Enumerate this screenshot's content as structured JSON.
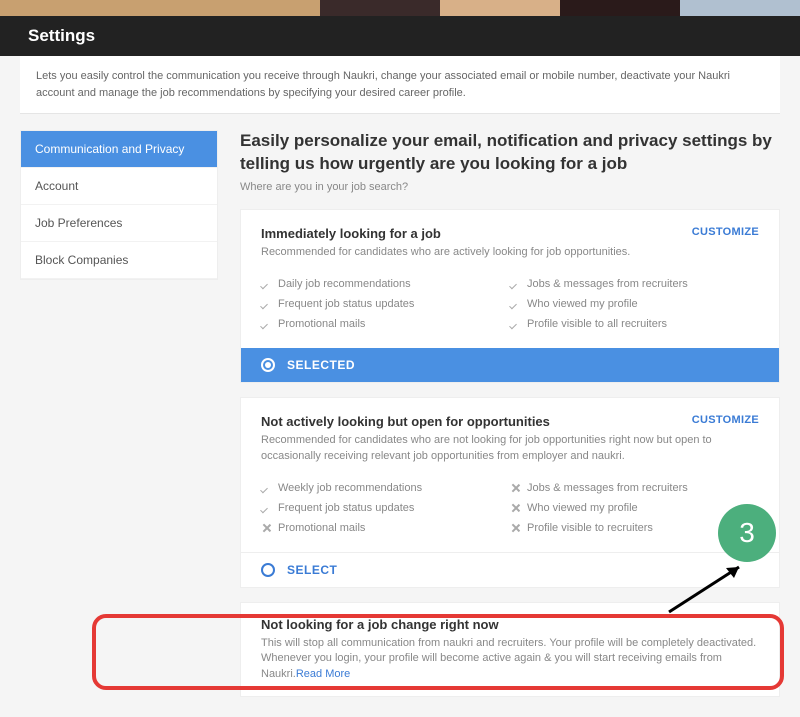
{
  "header": {
    "title": "Settings"
  },
  "intro": "Lets you easily control the communication you receive through Naukri, change your associated email or mobile number, deactivate your Naukri account and manage the job recommendations by specifying your desired career profile.",
  "sidebar": {
    "items": [
      {
        "label": "Communication and Privacy",
        "active": true
      },
      {
        "label": "Account",
        "active": false
      },
      {
        "label": "Job Preferences",
        "active": false
      },
      {
        "label": "Block Companies",
        "active": false
      }
    ]
  },
  "content": {
    "heading": "Easily personalize your email, notification and privacy settings by telling us how urgently are you looking for a job",
    "subheading": "Where are you in your job search?",
    "customize_label": "CUSTOMIZE",
    "selected_label": "SELECTED",
    "select_label": "SELECT",
    "read_more": "Read More"
  },
  "options": [
    {
      "title": "Immediately looking for a job",
      "desc": "Recommended for candidates who are actively looking for job opportunities.",
      "selected": true,
      "left": [
        {
          "icon": "check",
          "text": "Daily job recommendations"
        },
        {
          "icon": "check",
          "text": "Frequent job status updates"
        },
        {
          "icon": "check",
          "text": "Promotional mails"
        }
      ],
      "right": [
        {
          "icon": "check",
          "text": "Jobs & messages from recruiters"
        },
        {
          "icon": "check",
          "text": "Who viewed my profile"
        },
        {
          "icon": "check",
          "text": "Profile visible to all recruiters"
        }
      ]
    },
    {
      "title": "Not actively looking but open for opportunities",
      "desc": "Recommended for candidates who are not looking for job opportunities right now but open to occasionally receiving relevant job opportunities from employer and naukri.",
      "selected": false,
      "left": [
        {
          "icon": "check",
          "text": "Weekly job recommendations"
        },
        {
          "icon": "check",
          "text": "Frequent job status updates"
        },
        {
          "icon": "x",
          "text": "Promotional mails"
        }
      ],
      "right": [
        {
          "icon": "x",
          "text": "Jobs & messages from recruiters"
        },
        {
          "icon": "x",
          "text": "Who viewed my profile"
        },
        {
          "icon": "x",
          "text": "Profile visible to recruiters"
        }
      ]
    },
    {
      "title": "Not looking for a job change right now",
      "desc": "This will stop all communication from naukri and recruiters. Your profile will be completely deactivated. Whenever you login, your profile will become active again & you will start receiving emails from Naukri."
    }
  ],
  "annotation": {
    "step": "3"
  }
}
